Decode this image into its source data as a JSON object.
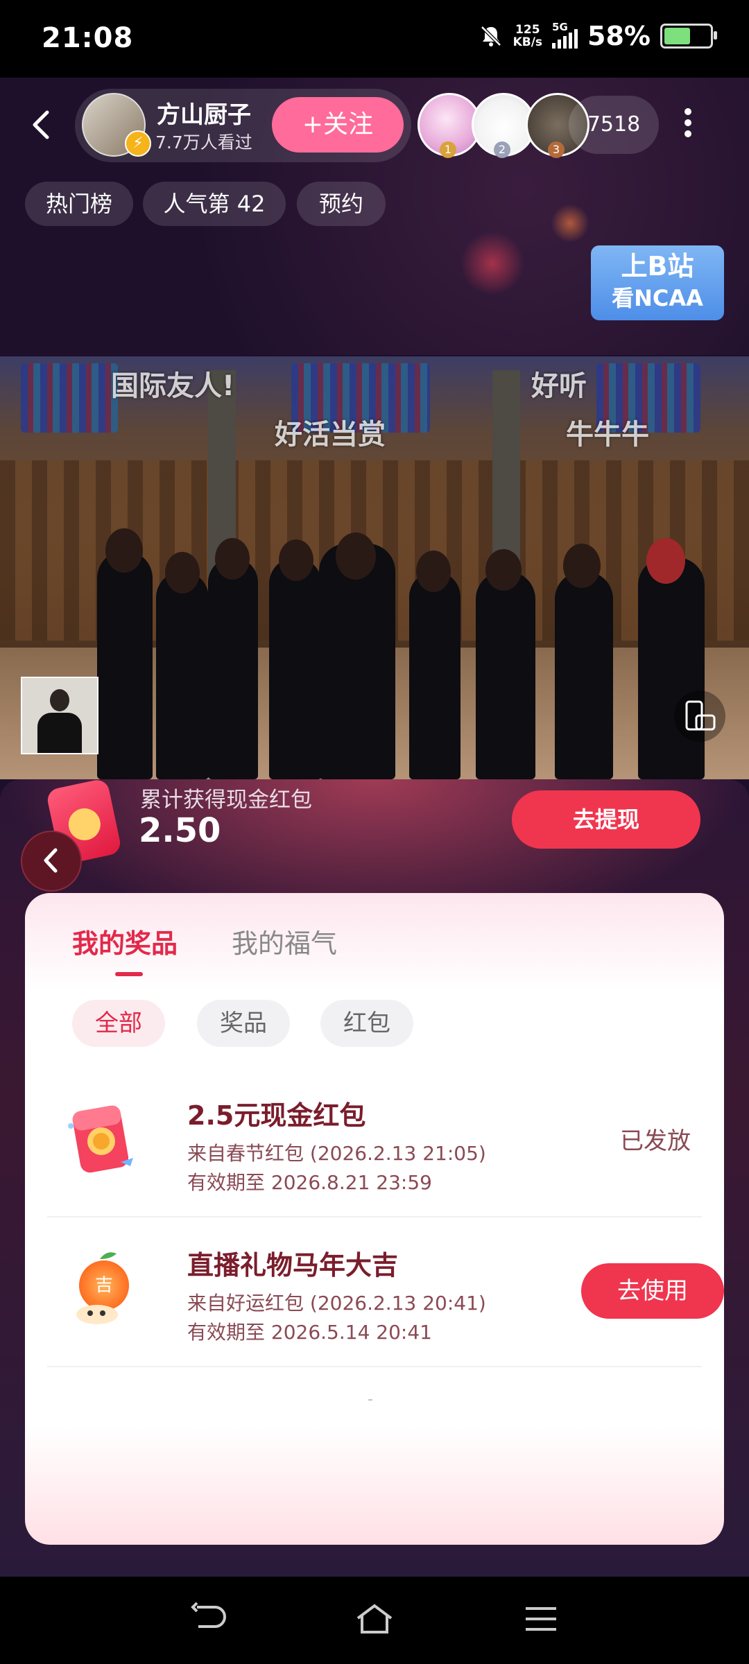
{
  "status_bar": {
    "time": "21:08",
    "net_speed": "125",
    "net_unit": "KB/s",
    "signal": "5G",
    "battery_percent": "58%",
    "battery_level": 0.58,
    "icons": [
      "mute-icon",
      "signal-icon",
      "battery-icon"
    ]
  },
  "header": {
    "anchor_name": "方山厨子",
    "watch_count": "7.7万人看过",
    "follow_label": "+关注",
    "ranks": [
      "1",
      "2",
      "3"
    ],
    "viewer_count": "7518",
    "chips": [
      "热门榜",
      "人气第 42",
      "预约"
    ],
    "promo_line1": "上B站",
    "promo_line2": "看NCAA"
  },
  "video": {
    "danmaku": [
      "国际友人!",
      "好听",
      "好活当赏",
      "牛牛牛"
    ]
  },
  "reward": {
    "cumulative_label": "累计获得现金红包",
    "cumulative_value": "2.50",
    "withdraw_label": "去提现"
  },
  "card": {
    "tabs": [
      {
        "label": "我的奖品",
        "active": true
      },
      {
        "label": "我的福气",
        "active": false
      }
    ],
    "filters": [
      {
        "label": "全部",
        "active": true
      },
      {
        "label": "奖品",
        "active": false
      },
      {
        "label": "红包",
        "active": false
      }
    ],
    "prizes": [
      {
        "title": "2.5元现金红包",
        "from": "来自春节红包 (2026.2.13 21:05)",
        "expiry": "有效期至 2026.8.21 23:59",
        "status": "已发放",
        "icon": "red-envelope-icon"
      },
      {
        "title": "直播礼物马年大吉",
        "from": "来自好运红包 (2026.2.13 20:41)",
        "expiry": "有效期至 2026.5.14 20:41",
        "action": "去使用",
        "icon": "tangerine-gift-icon"
      }
    ],
    "end_marker": "-"
  },
  "colors": {
    "accent": "#f0354f",
    "follow": "#ff6b9a",
    "prize_title": "#7a1d2c"
  }
}
